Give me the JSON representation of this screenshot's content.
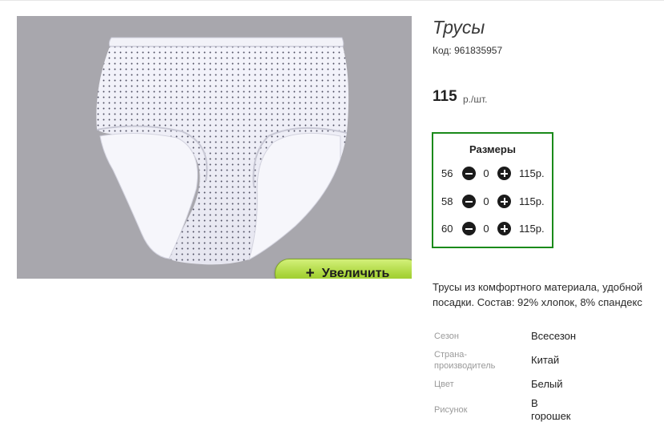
{
  "product": {
    "title": "Трусы",
    "code_label": "Код:",
    "code": "961835957",
    "price": "115",
    "price_unit": "р./шт."
  },
  "zoom_button": {
    "icon": "plus-icon",
    "label": "Увеличить"
  },
  "sizes": {
    "title": "Размеры",
    "rows": [
      {
        "size": "56",
        "qty": "0",
        "price": "115р."
      },
      {
        "size": "58",
        "qty": "0",
        "price": "115р."
      },
      {
        "size": "60",
        "qty": "0",
        "price": "115р."
      }
    ]
  },
  "description": "Трусы из комфортного материала, удобной посадки. Состав: 92% хлопок, 8% спандекс",
  "attributes": [
    {
      "label": "Сезон",
      "value": "Всесезон"
    },
    {
      "label": "Страна-\nпроизводитель",
      "value": "Китай"
    },
    {
      "label": "Цвет",
      "value": "Белый"
    },
    {
      "label": "Рисунок",
      "value": "В\nгорошек"
    }
  ],
  "colors": {
    "accent_border": "#1a8a1a",
    "zoom_button": "#a9d53a",
    "photo_background": "#a8a7ad"
  }
}
